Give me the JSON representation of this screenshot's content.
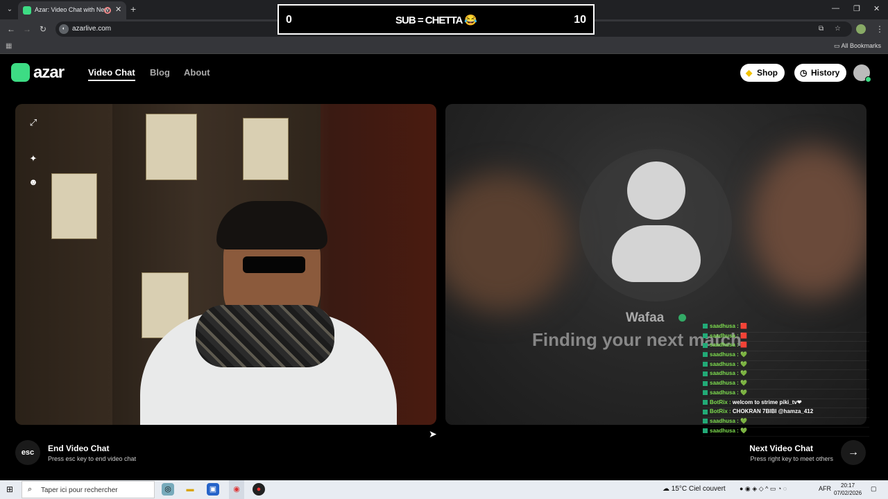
{
  "browser": {
    "tab_title": "Azar: Video Chat with New",
    "url": "azarlive.com",
    "all_bookmarks": "All Bookmarks"
  },
  "overlay": {
    "left_count": "0",
    "middle_text": "SUB = CHETTA 😂",
    "right_count": "10"
  },
  "site": {
    "logo": "azar",
    "nav": [
      "Video Chat",
      "Blog",
      "About"
    ],
    "shop_label": "Shop",
    "history_label": "History"
  },
  "match": {
    "name": "Wafaa",
    "status_text": "Finding your next match"
  },
  "chat": [
    {
      "user": "saadhusa :",
      "msg": "🟥",
      "kind": "user"
    },
    {
      "user": "saadhusa :",
      "msg": "🟥",
      "kind": "user"
    },
    {
      "user": "saadhusa :",
      "msg": "🟥",
      "kind": "user"
    },
    {
      "user": "saadhusa :",
      "msg": "💚",
      "kind": "user"
    },
    {
      "user": "saadhusa :",
      "msg": "💚",
      "kind": "user"
    },
    {
      "user": "saadhusa :",
      "msg": "💚",
      "kind": "user"
    },
    {
      "user": "saadhusa :",
      "msg": "💚",
      "kind": "user"
    },
    {
      "user": "saadhusa :",
      "msg": "💚",
      "kind": "user"
    },
    {
      "user": "BotRix :",
      "msg": "welcom to strime piki_tv❤",
      "kind": "bot"
    },
    {
      "user": "BotRix :",
      "msg": "CHOKRAN 7BIBI @hamza_412",
      "kind": "bot"
    },
    {
      "user": "saadhusa :",
      "msg": "💚",
      "kind": "user"
    },
    {
      "user": "saadhusa :",
      "msg": "💚",
      "kind": "user"
    }
  ],
  "controls": {
    "esc_label": "esc",
    "end_title": "End Video Chat",
    "end_sub": "Press esc key to end video chat",
    "next_title": "Next Video Chat",
    "next_sub": "Press right key to meet others"
  },
  "taskbar": {
    "search_placeholder": "Taper ici pour rechercher",
    "weather": "15°C  Ciel couvert",
    "lang": "AFR",
    "time": "20:17",
    "date": "07/02/2026"
  }
}
